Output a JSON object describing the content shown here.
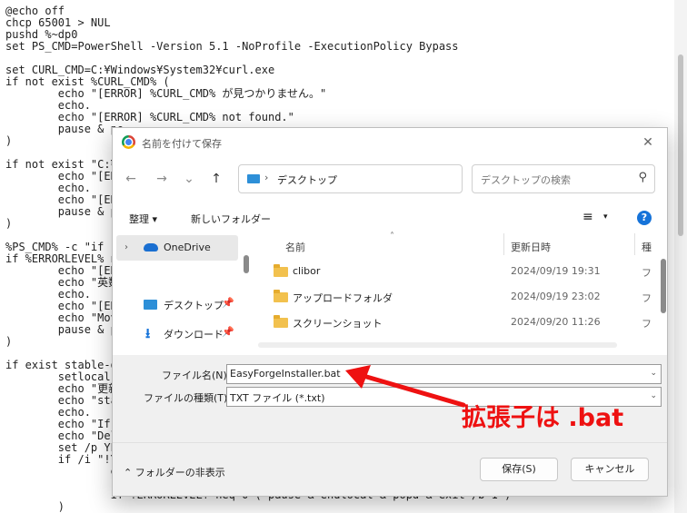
{
  "editor": {
    "code": "@echo off\nchcp 65001 > NUL\npushd %~dp0\nset PS_CMD=PowerShell -Version 5.1 -NoProfile -ExecutionPolicy Bypass\n\nset CURL_CMD=C:¥Windows¥System32¥curl.exe\nif not exist %CURL_CMD% (\n        echo \"[ERROR] %CURL_CMD% が見つかりません。\"\n        echo.\n        echo \"[ERROR] %CURL_CMD% not found.\"\n        pause & po\n)\n\nif not exist \"C:¥W\n        echo \"[ERR\n        echo.\n        echo \"[ERR\n        pause & po\n)\n\n%PS_CMD% -c \"if ('\nif %ERRORLEVEL% ne\n        echo \"[ERR\n        echo \"英数\n        echo.\n        echo \"[ERR\n        echo \"Move\n        pause & po\n)\n\nif exist stable-di\n        setlocal e\n        echo \"更新\n        echo \"stab\n        echo.\n        echo \"If y\n        echo \"Dele\n        set /p YES\n        if /i \"!YE\n                ec\n                rm\n                if !ERRORLEVEL! neq 0 ( pause & endlocal & popd & exit /b 1 )\n        )"
  },
  "dialog": {
    "title": "名前を付けて保存",
    "close_glyph": "✕",
    "nav": {
      "back": "←",
      "forward": "→",
      "recent": "⌄",
      "up": "↑",
      "refresh": "↻"
    },
    "address": {
      "separator": "›",
      "location": "デスクトップ"
    },
    "search": {
      "placeholder": "デスクトップの検索",
      "icon": "⚲"
    },
    "toolbar": {
      "organize": "整理 ▾",
      "new_folder": "新しいフォルダー",
      "view_icon": "≡",
      "view_dropdown": "▾",
      "help": "?"
    },
    "nav_pane": {
      "chevron": "›",
      "items": [
        {
          "label": "OneDrive"
        },
        {
          "label": "デスクトップ",
          "pin": "📌"
        },
        {
          "label": "ダウンロード",
          "pin": "📌",
          "icon": "⭳"
        }
      ]
    },
    "file_list": {
      "columns": {
        "name": "名前",
        "date": "更新日時",
        "type": "種"
      },
      "sort_glyph": "˄",
      "rows": [
        {
          "name": "clibor",
          "date": "2024/09/19 19:31",
          "type": "フ"
        },
        {
          "name": "アップロードフォルダ",
          "date": "2024/09/19 23:02",
          "type": "フ"
        },
        {
          "name": "スクリーンショット",
          "date": "2024/09/20 11:26",
          "type": "フ"
        }
      ]
    },
    "fields": {
      "filename_label": "ファイル名(N):",
      "filename_value": "EasyForgeInstaller.bat",
      "filetype_label": "ファイルの種類(T):",
      "filetype_value": "TXT ファイル (*.txt)",
      "dropdown_glyph": "⌄"
    },
    "footer": {
      "hide_folders": "⌃  フォルダーの非表示",
      "save": "保存(S)",
      "cancel": "キャンセル"
    }
  },
  "annotation": {
    "text": "拡張子は .bat",
    "color": "#ee1111"
  }
}
